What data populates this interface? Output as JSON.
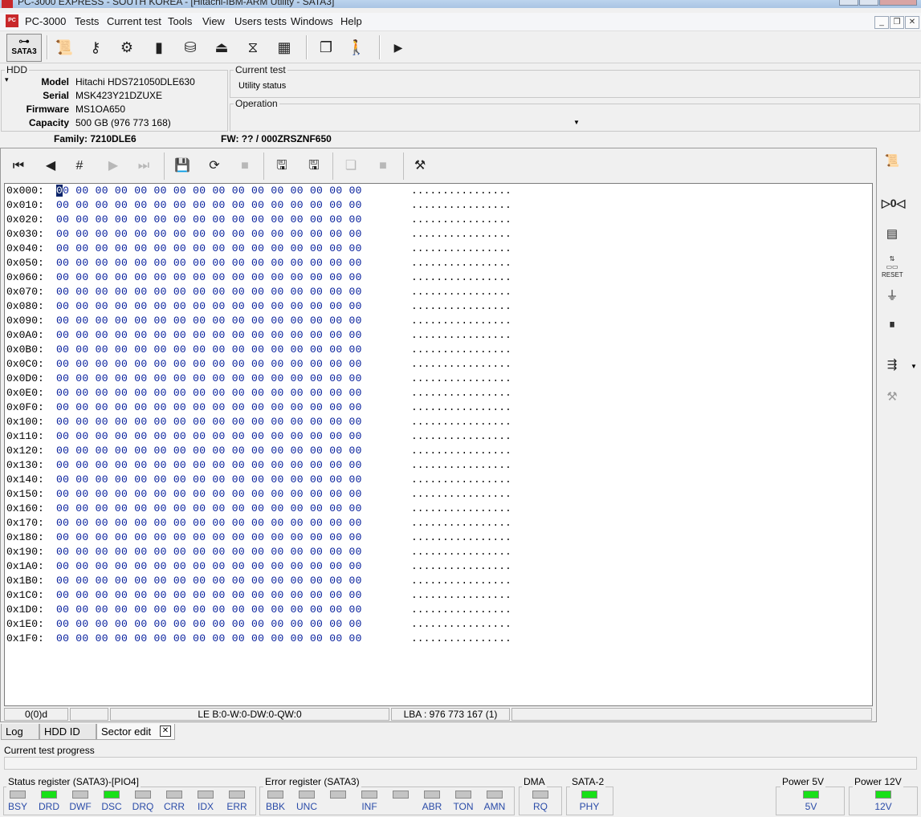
{
  "window": {
    "title": "PC-3000 EXPRESS - SOUTH KOREA - [Hitachi-IBM-ARM Utility - SATA3]"
  },
  "menu": {
    "items": [
      "PC-3000",
      "Tests",
      "Current test",
      "Tools",
      "View",
      "Users tests",
      "Windows",
      "Help"
    ]
  },
  "toolbar": {
    "sata_label": "SATA3"
  },
  "hdd": {
    "group_label": "HDD",
    "fields": [
      {
        "key": "Model",
        "value": "Hitachi HDS721050DLE630"
      },
      {
        "key": "Serial",
        "value": "MSK423Y21DZUXE"
      },
      {
        "key": "Firmware",
        "value": "MS1OA650"
      },
      {
        "key": "Capacity",
        "value": "500 GB (976 773 168)"
      }
    ],
    "family": "Family: 7210DLE6",
    "fw": "FW: ?? / 000ZRSZNF650"
  },
  "current_test": {
    "label": "Current test",
    "value": "Utility status"
  },
  "operation": {
    "label": "Operation",
    "value": ""
  },
  "hex": {
    "rows": [
      {
        "addr": "0x000:",
        "bytes": "00 00 00 00 00 00 00 00 00 00 00 00 00 00 00 00",
        "ascii": "................"
      },
      {
        "addr": "0x010:",
        "bytes": "00 00 00 00 00 00 00 00 00 00 00 00 00 00 00 00",
        "ascii": "................"
      },
      {
        "addr": "0x020:",
        "bytes": "00 00 00 00 00 00 00 00 00 00 00 00 00 00 00 00",
        "ascii": "................"
      },
      {
        "addr": "0x030:",
        "bytes": "00 00 00 00 00 00 00 00 00 00 00 00 00 00 00 00",
        "ascii": "................"
      },
      {
        "addr": "0x040:",
        "bytes": "00 00 00 00 00 00 00 00 00 00 00 00 00 00 00 00",
        "ascii": "................"
      },
      {
        "addr": "0x050:",
        "bytes": "00 00 00 00 00 00 00 00 00 00 00 00 00 00 00 00",
        "ascii": "................"
      },
      {
        "addr": "0x060:",
        "bytes": "00 00 00 00 00 00 00 00 00 00 00 00 00 00 00 00",
        "ascii": "................"
      },
      {
        "addr": "0x070:",
        "bytes": "00 00 00 00 00 00 00 00 00 00 00 00 00 00 00 00",
        "ascii": "................"
      },
      {
        "addr": "0x080:",
        "bytes": "00 00 00 00 00 00 00 00 00 00 00 00 00 00 00 00",
        "ascii": "................"
      },
      {
        "addr": "0x090:",
        "bytes": "00 00 00 00 00 00 00 00 00 00 00 00 00 00 00 00",
        "ascii": "................"
      },
      {
        "addr": "0x0A0:",
        "bytes": "00 00 00 00 00 00 00 00 00 00 00 00 00 00 00 00",
        "ascii": "................"
      },
      {
        "addr": "0x0B0:",
        "bytes": "00 00 00 00 00 00 00 00 00 00 00 00 00 00 00 00",
        "ascii": "................"
      },
      {
        "addr": "0x0C0:",
        "bytes": "00 00 00 00 00 00 00 00 00 00 00 00 00 00 00 00",
        "ascii": "................"
      },
      {
        "addr": "0x0D0:",
        "bytes": "00 00 00 00 00 00 00 00 00 00 00 00 00 00 00 00",
        "ascii": "................"
      },
      {
        "addr": "0x0E0:",
        "bytes": "00 00 00 00 00 00 00 00 00 00 00 00 00 00 00 00",
        "ascii": "................"
      },
      {
        "addr": "0x0F0:",
        "bytes": "00 00 00 00 00 00 00 00 00 00 00 00 00 00 00 00",
        "ascii": "................"
      },
      {
        "addr": "0x100:",
        "bytes": "00 00 00 00 00 00 00 00 00 00 00 00 00 00 00 00",
        "ascii": "................"
      },
      {
        "addr": "0x110:",
        "bytes": "00 00 00 00 00 00 00 00 00 00 00 00 00 00 00 00",
        "ascii": "................"
      },
      {
        "addr": "0x120:",
        "bytes": "00 00 00 00 00 00 00 00 00 00 00 00 00 00 00 00",
        "ascii": "................"
      },
      {
        "addr": "0x130:",
        "bytes": "00 00 00 00 00 00 00 00 00 00 00 00 00 00 00 00",
        "ascii": "................"
      },
      {
        "addr": "0x140:",
        "bytes": "00 00 00 00 00 00 00 00 00 00 00 00 00 00 00 00",
        "ascii": "................"
      },
      {
        "addr": "0x150:",
        "bytes": "00 00 00 00 00 00 00 00 00 00 00 00 00 00 00 00",
        "ascii": "................"
      },
      {
        "addr": "0x160:",
        "bytes": "00 00 00 00 00 00 00 00 00 00 00 00 00 00 00 00",
        "ascii": "................"
      },
      {
        "addr": "0x170:",
        "bytes": "00 00 00 00 00 00 00 00 00 00 00 00 00 00 00 00",
        "ascii": "................"
      },
      {
        "addr": "0x180:",
        "bytes": "00 00 00 00 00 00 00 00 00 00 00 00 00 00 00 00",
        "ascii": "................"
      },
      {
        "addr": "0x190:",
        "bytes": "00 00 00 00 00 00 00 00 00 00 00 00 00 00 00 00",
        "ascii": "................"
      },
      {
        "addr": "0x1A0:",
        "bytes": "00 00 00 00 00 00 00 00 00 00 00 00 00 00 00 00",
        "ascii": "................"
      },
      {
        "addr": "0x1B0:",
        "bytes": "00 00 00 00 00 00 00 00 00 00 00 00 00 00 00 00",
        "ascii": "................"
      },
      {
        "addr": "0x1C0:",
        "bytes": "00 00 00 00 00 00 00 00 00 00 00 00 00 00 00 00",
        "ascii": "................"
      },
      {
        "addr": "0x1D0:",
        "bytes": "00 00 00 00 00 00 00 00 00 00 00 00 00 00 00 00",
        "ascii": "................"
      },
      {
        "addr": "0x1E0:",
        "bytes": "00 00 00 00 00 00 00 00 00 00 00 00 00 00 00 00",
        "ascii": "................"
      },
      {
        "addr": "0x1F0:",
        "bytes": "00 00 00 00 00 00 00 00 00 00 00 00 00 00 00 00",
        "ascii": "................"
      }
    ]
  },
  "statusbar": {
    "position": "0(0)d",
    "cell2": "",
    "le": "LE B:0-W:0-DW:0-QW:0",
    "lba": "LBA : 976 773 167 (1)"
  },
  "tabs": {
    "log": "Log",
    "hdd_id": "HDD ID",
    "sector_edit": "Sector edit",
    "close": "✕"
  },
  "progress": {
    "label": "Current test progress",
    "percent": 0
  },
  "status_register": {
    "title": "Status register (SATA3)-[PIO4]",
    "leds": [
      {
        "name": "BSY",
        "on": false
      },
      {
        "name": "DRD",
        "on": true
      },
      {
        "name": "DWF",
        "on": false
      },
      {
        "name": "DSC",
        "on": true
      },
      {
        "name": "DRQ",
        "on": false
      },
      {
        "name": "CRR",
        "on": false
      },
      {
        "name": "IDX",
        "on": false
      },
      {
        "name": "ERR",
        "on": false
      }
    ]
  },
  "error_register": {
    "title": "Error register (SATA3)",
    "leds": [
      {
        "name": "BBK",
        "on": false
      },
      {
        "name": "UNC",
        "on": false
      },
      {
        "name": "",
        "on": false
      },
      {
        "name": "INF",
        "on": false
      },
      {
        "name": "",
        "on": false
      },
      {
        "name": "ABR",
        "on": false
      },
      {
        "name": "TON",
        "on": false
      },
      {
        "name": "AMN",
        "on": false
      }
    ]
  },
  "dma": {
    "title": "DMA",
    "led": {
      "name": "RQ",
      "on": false
    }
  },
  "sata2": {
    "title": "SATA-2",
    "led": {
      "name": "PHY",
      "on": true
    }
  },
  "power5": {
    "title": "Power 5V",
    "led": {
      "name": "5V",
      "on": true
    }
  },
  "power12": {
    "title": "Power 12V",
    "led": {
      "name": "12V",
      "on": true
    }
  },
  "colors": {
    "led_on": "#18e018",
    "led_off": "#c4c4c4",
    "hex_bytes": "#001a9a",
    "reg_label": "#2a4ba8"
  }
}
